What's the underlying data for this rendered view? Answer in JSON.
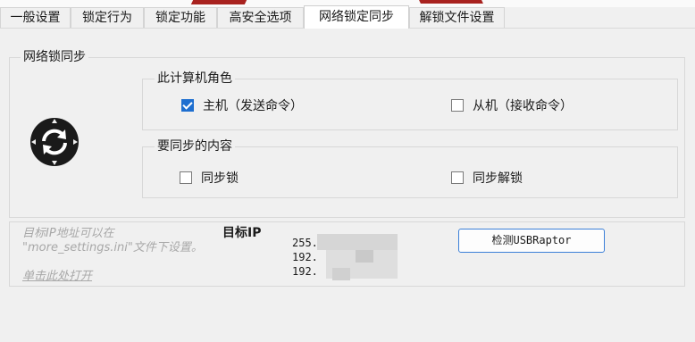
{
  "tabs": [
    "一般设置",
    "锁定行为",
    "锁定功能",
    "高安全选项",
    "网络锁定同步",
    "解锁文件设置"
  ],
  "active_tab": "网络锁定同步",
  "network_sync": {
    "group_title": "网络锁同步",
    "role": {
      "title": "此计算机角色",
      "master_label": "主机（发送命令）",
      "master_checked": true,
      "slave_label": "从机（接收命令）",
      "slave_checked": false
    },
    "content": {
      "title": "要同步的内容",
      "sync_lock_label": "同步锁",
      "sync_lock_checked": false,
      "sync_unlock_label": "同步解锁",
      "sync_unlock_checked": false
    },
    "sync_icon": "sync-icon"
  },
  "target_ip": {
    "hint_line1": "目标IP地址可以在",
    "hint_line2": "\"more_settings.ini\"文件下设置。",
    "link": "单击此处打开",
    "title": "目标IP",
    "ips": [
      "255.",
      "192.",
      "192."
    ],
    "detect_button": "检测USBRaptor"
  },
  "colors": {
    "accent": "#1e6fd0",
    "hint": "#a8a8a8",
    "brand_red": "#a8221f"
  }
}
